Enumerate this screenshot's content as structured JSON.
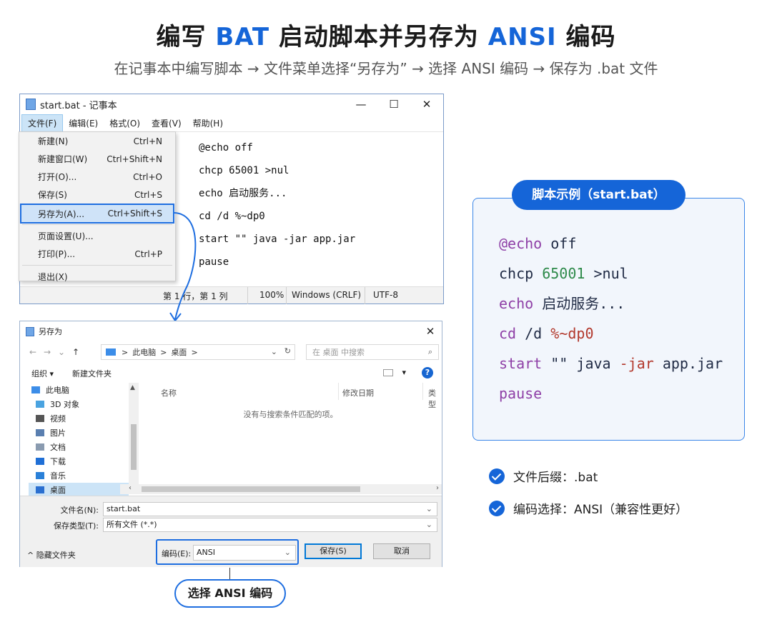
{
  "header": {
    "title_pre": "编写 ",
    "title_bat": "BAT",
    "title_mid": " 启动脚本并另存为 ",
    "title_ansi": "ANSI",
    "title_post": " 编码",
    "subtitle": "在记事本中编写脚本 → 文件菜单选择“另存为” → 选择 ANSI 编码 → 保存为 .bat 文件"
  },
  "notepad": {
    "window_title": "start.bat - 记事本",
    "controls": {
      "minimize": "—",
      "maximize": "☐",
      "close": "✕"
    },
    "menus": [
      "文件(F)",
      "编辑(E)",
      "格式(O)",
      "查看(V)",
      "帮助(H)"
    ],
    "code_lines": [
      "@echo off",
      "chcp 65001 >nul",
      "echo 启动服务...",
      "cd /d %~dp0",
      "start \"\" java -jar app.jar",
      "pause"
    ],
    "status": {
      "position": "第 1 行，第 1 列",
      "zoom": "100%",
      "line_ending": "Windows (CRLF)",
      "encoding": "UTF-8"
    }
  },
  "file_menu": {
    "items": [
      {
        "label": "新建(N)",
        "shortcut": "Ctrl+N"
      },
      {
        "label": "新建窗口(W)",
        "shortcut": "Ctrl+Shift+N"
      },
      {
        "label": "打开(O)...",
        "shortcut": "Ctrl+O"
      },
      {
        "label": "保存(S)",
        "shortcut": "Ctrl+S"
      },
      {
        "label": "另存为(A)...",
        "shortcut": "Ctrl+Shift+S"
      },
      {
        "label": "页面设置(U)...",
        "shortcut": ""
      },
      {
        "label": "打印(P)...",
        "shortcut": "Ctrl+P"
      },
      {
        "label": "退出(X)",
        "shortcut": ""
      }
    ]
  },
  "save_dialog": {
    "title": "另存为",
    "close": "✕",
    "nav": {
      "back": "←",
      "forward": "→",
      "recent": "⌄",
      "up": "↑"
    },
    "breadcrumb": [
      "此电脑",
      ">",
      "桌面",
      ">"
    ],
    "search_placeholder": "在 桌面 中搜索",
    "toolbar": {
      "organize": "组织 ▾",
      "new_folder": "新建文件夹"
    },
    "help": "?",
    "tree": [
      {
        "label": "此电脑",
        "icon": "computer-icon",
        "color": "#3c8de8"
      },
      {
        "label": "3D 对象",
        "icon": "cube-icon",
        "color": "#4aa3e0"
      },
      {
        "label": "视频",
        "icon": "video-icon",
        "color": "#555555"
      },
      {
        "label": "图片",
        "icon": "pictures-icon",
        "color": "#5a7fb0"
      },
      {
        "label": "文档",
        "icon": "documents-icon",
        "color": "#8a9bb0"
      },
      {
        "label": "下载",
        "icon": "download-icon",
        "color": "#1f6fd6"
      },
      {
        "label": "音乐",
        "icon": "music-icon",
        "color": "#2a80d8"
      },
      {
        "label": "桌面",
        "icon": "desktop-icon",
        "color": "#2a6fd0"
      }
    ],
    "columns": [
      "名称",
      "修改日期",
      "类型"
    ],
    "empty_message": "没有与搜索条件匹配的项。",
    "filename_label": "文件名(N):",
    "filename_value": "start.bat",
    "filetype_label": "保存类型(T):",
    "filetype_value": "所有文件 (*.*)",
    "hide_folders": "^ 隐藏文件夹",
    "encoding_label": "编码(E):",
    "encoding_value": "ANSI",
    "save_button": "保存(S)",
    "cancel_button": "取消"
  },
  "callout": "选择 ANSI 编码",
  "example_panel": {
    "tag": "脚本示例（start.bat）"
  },
  "checklist": [
    "文件后缀：.bat",
    "编码选择：ANSI（兼容性更好）"
  ],
  "colors": {
    "accent": "#1565d8",
    "panel_bg": "#f2f6fc",
    "highlight": "#cfe3f8"
  }
}
